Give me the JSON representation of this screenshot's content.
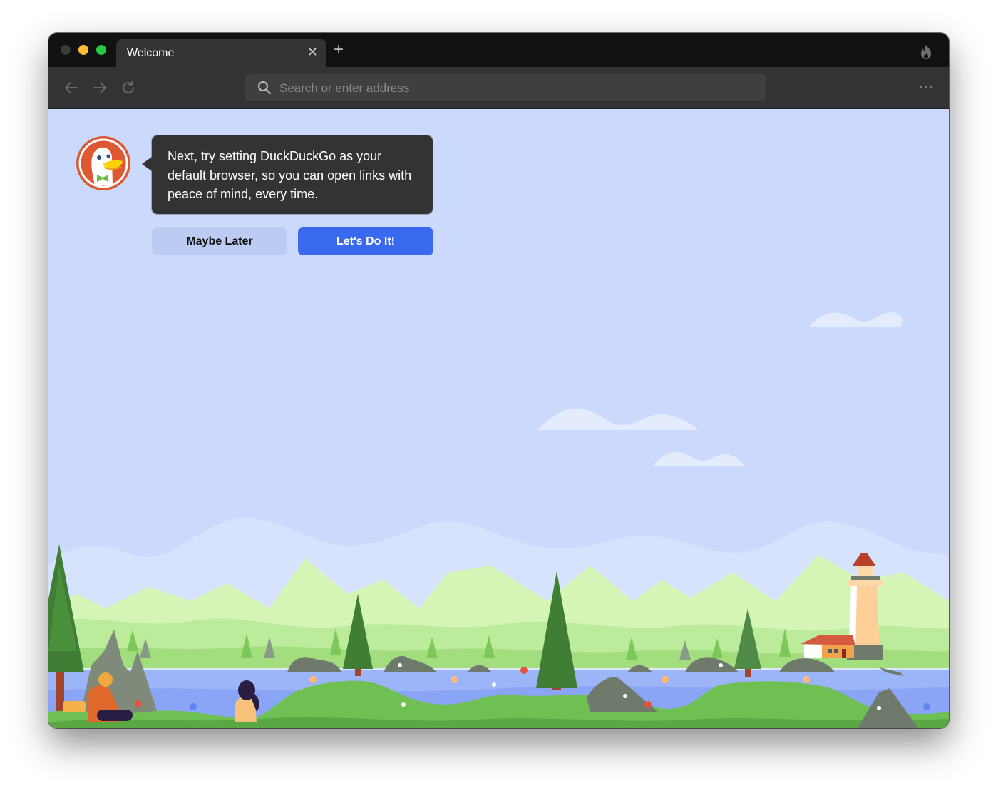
{
  "window": {
    "traffic_lights": [
      "close",
      "minimize",
      "maximize"
    ]
  },
  "tabs": [
    {
      "title": "Welcome",
      "close_icon": "close-icon"
    }
  ],
  "tab_bar": {
    "new_tab_icon": "plus-icon",
    "fire_icon": "fire-icon"
  },
  "toolbar": {
    "back_icon": "arrow-left-icon",
    "forward_icon": "arrow-right-icon",
    "reload_icon": "reload-icon",
    "address_value": "",
    "address_placeholder": "Search or enter address",
    "menu_icon": "more-horizontal-icon"
  },
  "onboarding": {
    "message": "Next, try setting DuckDuckGo as your default browser, so you can open links with peace of mind, every time.",
    "secondary_button": "Maybe Later",
    "primary_button": "Let's Do It!"
  },
  "colors": {
    "sky": "#cbd9fd",
    "primary": "#3969ef",
    "secondary": "#bccbf1",
    "bubble": "#333333",
    "brand_orange": "#de5833"
  }
}
